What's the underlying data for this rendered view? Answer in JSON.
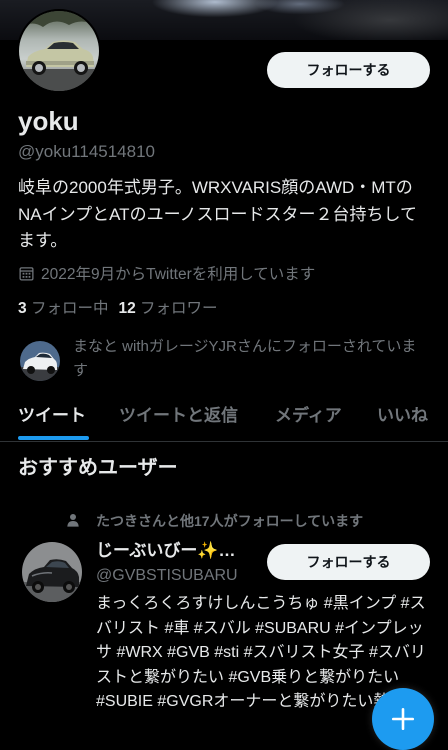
{
  "profile": {
    "name": "yoku",
    "handle": "@yoku114514810",
    "bio": "岐阜の2000年式男子。WRXVARIS顔のAWD・MTのNAインプとATのユーノスロードスター２台持ちしてます。",
    "joined": "2022年9月からTwitterを利用しています",
    "following_count": "3",
    "following_label": "フォロー中",
    "followers_count": "12",
    "followers_label": "フォロワー",
    "follow_button": "フォローする",
    "followed_by": "まなと withガレージYJRさんにフォローされています"
  },
  "tabs": [
    {
      "label": "ツイート",
      "active": true
    },
    {
      "label": "ツイートと返信",
      "active": false
    },
    {
      "label": "メディア",
      "active": false
    },
    {
      "label": "いいね",
      "active": false
    }
  ],
  "suggestions": {
    "title": "おすすめユーザー",
    "social_context": "たつきさんと他17人がフォローしています",
    "user": {
      "name": "じーぶいびー✨…",
      "handle": "@GVBSTISUBARU",
      "bio": "まっくろくろすけしんこうちゅ #黒インプ #スバリスト #車 #スバル #SUBARU #インプレッサ #WRX #GVB #sti #スバリスト女子 #スバリストと繋がりたい #GVB乗りと繋がりたい #SUBIE #GVGRオーナーと繋がりたい熱望",
      "follow_button": "フォローする"
    }
  },
  "icons": {
    "join_date": "calendar-icon",
    "social_context": "person-icon",
    "compose": "plus-icon"
  },
  "colors": {
    "background": "#000000",
    "text_primary": "#e7e9ea",
    "text_secondary": "#71767b",
    "accent": "#1d9bf0",
    "divider": "#2f3336",
    "button_bg": "#eff3f4",
    "button_text": "#0f1419"
  }
}
